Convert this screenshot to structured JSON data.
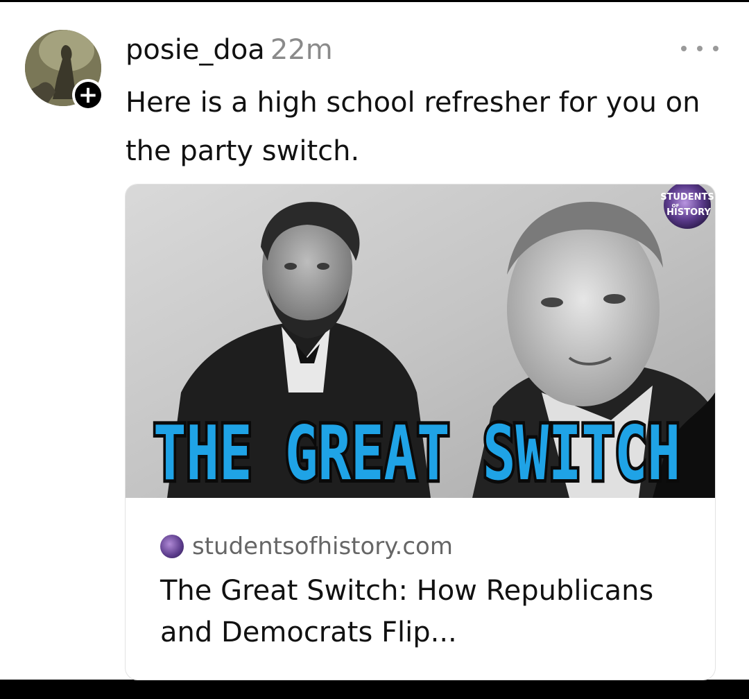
{
  "post": {
    "username": "posie_doa",
    "time": "22m",
    "text": "Here is a high school refresher for you on the party switch."
  },
  "link_card": {
    "image_title": "THE GREAT SWITCH",
    "image_logo_line1": "STUDENTS",
    "image_logo_line2": "OF",
    "image_logo_line3": "HISTORY",
    "domain": "studentsofhistory.com",
    "title": "The Great Switch: How Republicans and Democrats Flip..."
  },
  "colors": {
    "title_blue": "#1fa3e6",
    "logo_purple": "#5b3b8c"
  },
  "icons": {
    "more": "more-horizontal-icon",
    "follow": "plus-icon"
  }
}
